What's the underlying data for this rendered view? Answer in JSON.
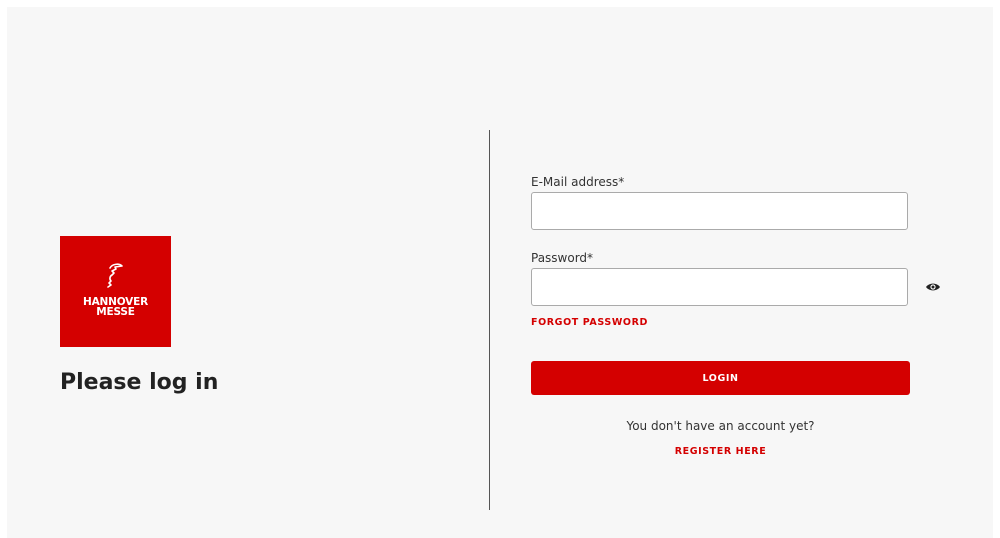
{
  "logo": {
    "line1": "HANNOVER",
    "line2": "MESSE",
    "icon": "hannover-messe-head-mark",
    "color": "#d40000"
  },
  "page_title": "Please log in",
  "form": {
    "email_label": "E-Mail address*",
    "email_value": "",
    "password_label": "Password*",
    "password_value": "",
    "show_password_icon": "eye-icon",
    "forgot_password": "FORGOT PASSWORD",
    "login_button": "LOGIN",
    "no_account_text": "You don't have an account yet?",
    "register_link": "REGISTER HERE"
  },
  "colors": {
    "accent": "#d40000",
    "panel_background": "#f7f7f7",
    "divider": "#555555"
  }
}
